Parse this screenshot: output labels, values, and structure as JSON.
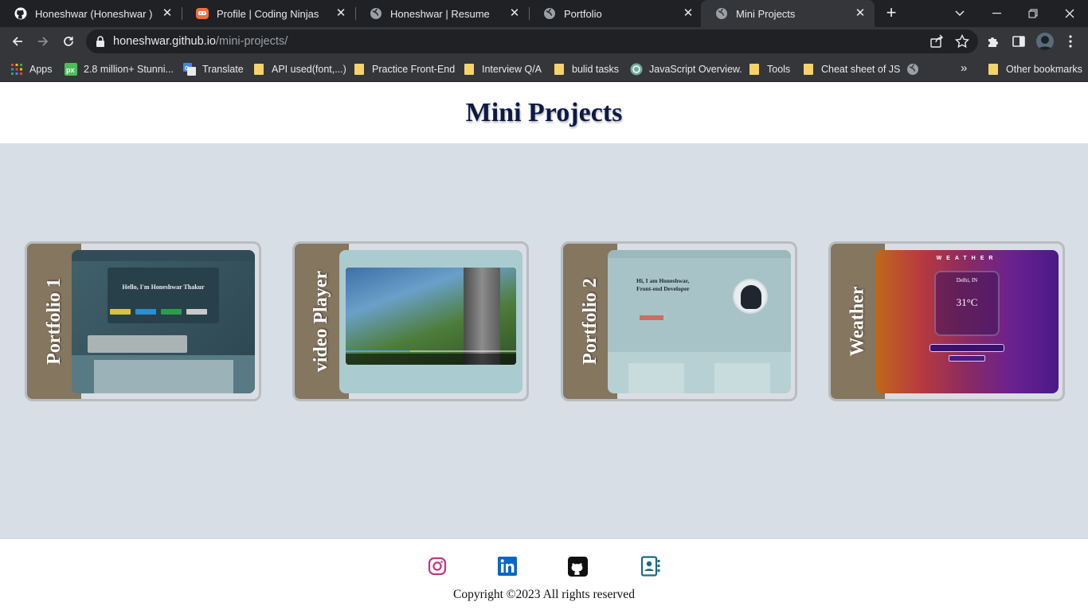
{
  "browser": {
    "tabs": [
      {
        "title": "Honeshwar (Honeshwar )",
        "icon": "github-icon",
        "active": false
      },
      {
        "title": "Profile | Coding Ninjas",
        "icon": "coding-ninjas-icon",
        "active": false
      },
      {
        "title": "Honeshwar | Resume",
        "icon": "globe-icon",
        "active": false
      },
      {
        "title": "Portfolio",
        "icon": "globe-icon",
        "active": false
      },
      {
        "title": "Mini Projects",
        "icon": "globe-icon",
        "active": true
      }
    ],
    "address": {
      "domain": "honeshwar.github.io",
      "path": "/mini-projects/"
    },
    "bookmarks": [
      {
        "label": "Apps",
        "icon": "apps-grid-icon"
      },
      {
        "label": "2.8 million+ Stunni...",
        "icon": "pixabay-icon"
      },
      {
        "label": "Translate",
        "icon": "google-translate-icon"
      },
      {
        "label": "API used(font,...)",
        "icon": "folder-icon"
      },
      {
        "label": "Practice Front-End",
        "icon": "folder-icon"
      },
      {
        "label": "Interview Q/A",
        "icon": "folder-icon"
      },
      {
        "label": "bulid tasks",
        "icon": "folder-icon"
      },
      {
        "label": "JavaScript Overview.",
        "icon": "chatgpt-icon"
      },
      {
        "label": "Tools",
        "icon": "folder-icon"
      },
      {
        "label": "Cheat sheet of JS",
        "icon": "folder-icon"
      },
      {
        "label": "",
        "icon": "globe-icon"
      }
    ],
    "other_bookmarks": "Other bookmarks",
    "overflow": "»"
  },
  "page": {
    "title": "Mini Projects",
    "projects": [
      {
        "label": "Portfolio 1",
        "preview_text": "Hello, I'm Honeshwar Thakur"
      },
      {
        "label": "video Player"
      },
      {
        "label": "Portfolio 2",
        "preview_text_1": "Hi, I am Honeshwar,",
        "preview_text_2": "Front-end Developer"
      },
      {
        "label": "Weather",
        "preview_title": "WEATHER",
        "preview_city": "Delhi, IN",
        "preview_temp": "31°C"
      }
    ]
  },
  "footer": {
    "social": [
      {
        "name": "instagram",
        "icon": "instagram-icon",
        "color": "#c13584"
      },
      {
        "name": "linkedin",
        "icon": "linkedin-icon",
        "color": "#0a66c2"
      },
      {
        "name": "github",
        "icon": "github-icon",
        "color": "#111111"
      },
      {
        "name": "contact",
        "icon": "contact-book-icon",
        "color": "#1c6b80"
      }
    ],
    "copyright": "Copyright ©2023 All rights reserved"
  }
}
